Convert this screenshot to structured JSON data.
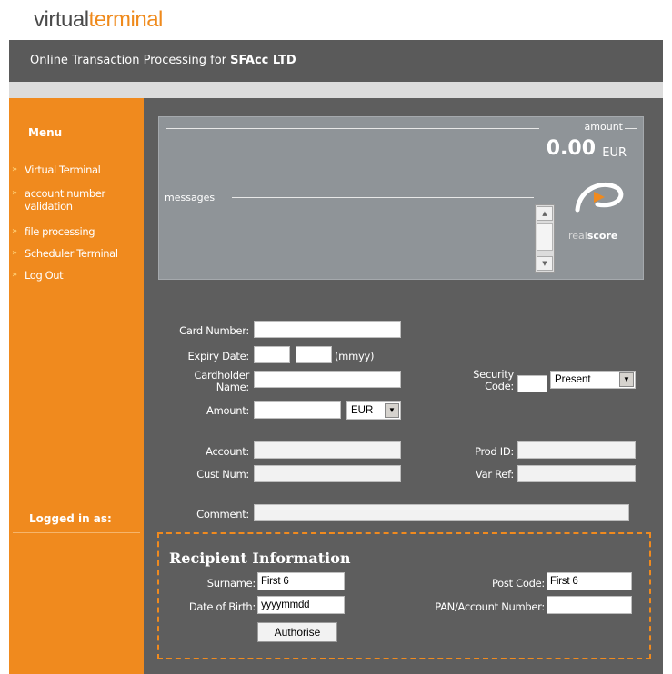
{
  "logo": {
    "part1": "virtual",
    "part2": "terminal"
  },
  "header": {
    "prefix": "Online Transaction Processing for ",
    "company": "SFAcc LTD"
  },
  "sidebar": {
    "menu_title": "Menu",
    "items": [
      {
        "label": "Virtual Terminal"
      },
      {
        "label": "account number validation"
      },
      {
        "label": "file processing"
      },
      {
        "label": "Scheduler Terminal"
      },
      {
        "label": "Log Out"
      }
    ],
    "logged_in_label": "Logged in as:"
  },
  "panel": {
    "amount_label": "amount",
    "amount_value": "0.00",
    "currency": "EUR",
    "messages_label": "messages",
    "realscore_part1": "real",
    "realscore_part2": "score"
  },
  "form": {
    "card_number_label": "Card Number:",
    "expiry_label": "Expiry Date:",
    "expiry_hint": "(mmyy)",
    "cardholder_label": "Cardholder Name:",
    "security_label": "Security Code:",
    "security_select": "Present",
    "amount_label": "Amount:",
    "amount_currency": "EUR",
    "account_label": "Account:",
    "prod_id_label": "Prod ID:",
    "cust_num_label": "Cust Num:",
    "var_ref_label": "Var Ref:",
    "comment_label": "Comment:"
  },
  "recipient": {
    "title": "Recipient Information",
    "surname_label": "Surname:",
    "surname_value": "First 6",
    "post_code_label": "Post Code:",
    "post_code_value": "First 6",
    "dob_label": "Date of Birth:",
    "dob_value": "yyyymmdd",
    "pan_label": "PAN/Account Number:",
    "pan_value": "",
    "authorise_button": "Authorise"
  },
  "colors": {
    "orange": "#f08a1e",
    "main_bg": "#5e5e5e",
    "title_bar": "#5a5a5a"
  }
}
